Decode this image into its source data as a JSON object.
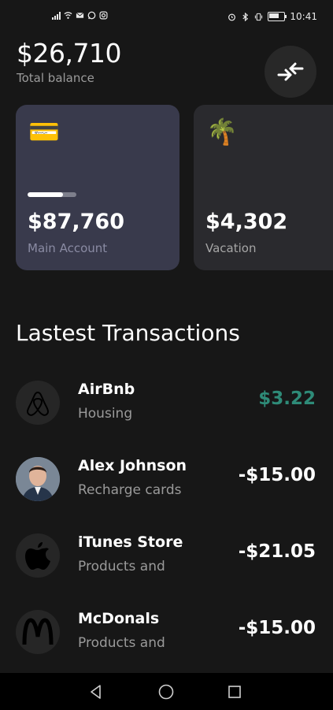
{
  "status_bar": {
    "time": "10:41"
  },
  "header": {
    "balance": "$26,710",
    "balance_label": "Total balance"
  },
  "accounts": [
    {
      "emoji": "💳",
      "amount": "$87,760",
      "name": "Main Account",
      "progress": 0.73
    },
    {
      "emoji": "🌴",
      "amount": "$4,302",
      "name": "Vacation"
    }
  ],
  "transactions_section": {
    "title": "Lastest Transactions",
    "items": [
      {
        "icon": "airbnb-logo-icon",
        "name": "AirBnb",
        "category": "Housing",
        "amount": "$3.22",
        "color": "#2e8b78"
      },
      {
        "icon": "avatar-photo",
        "name": "Alex Johnson",
        "category": "Recharge cards",
        "amount": "-$15.00"
      },
      {
        "icon": "apple-logo-icon",
        "name": "iTunes Store",
        "category": "Products and",
        "amount": "-$21.05"
      },
      {
        "icon": "mcdonalds-logo-icon",
        "name": "McDonals",
        "category": "Products and",
        "amount": "-$15.00"
      }
    ]
  },
  "colors": {
    "background": "#171717",
    "main_card": "#393a4c",
    "positive_amount": "#2e8b78"
  }
}
